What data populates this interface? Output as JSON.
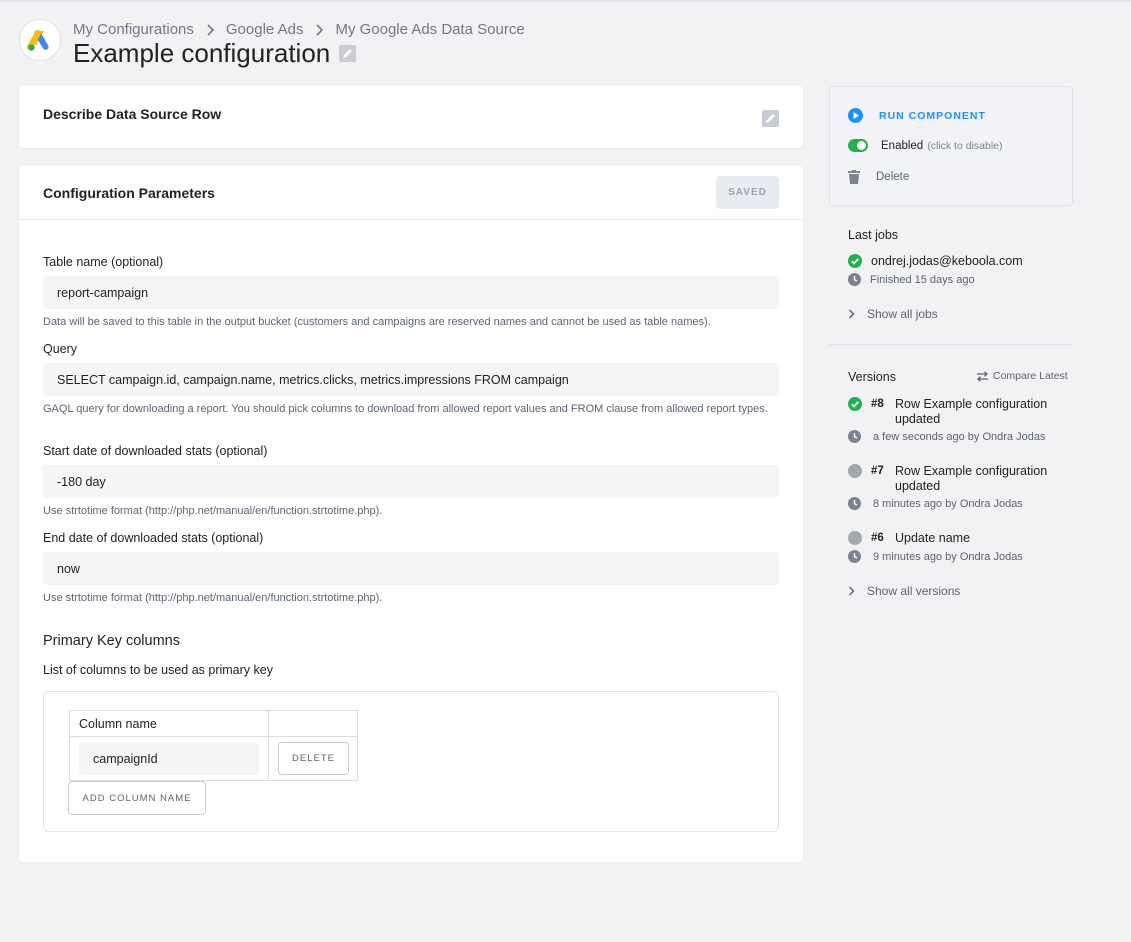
{
  "breadcrumb": {
    "items": [
      "My Configurations",
      "Google Ads",
      "My Google Ads Data Source"
    ]
  },
  "page": {
    "title": "Example configuration"
  },
  "describe": {
    "title": "Describe Data Source Row"
  },
  "config": {
    "title": "Configuration Parameters",
    "saved_label": "SAVED",
    "fields": [
      {
        "label": "Table name (optional)",
        "value": "report-campaign",
        "help": "Data will be saved to this table in the output bucket (customers and campaigns are reserved names and cannot be used as table names)."
      },
      {
        "label": "Query",
        "value": "SELECT campaign.id, campaign.name, metrics.clicks, metrics.impressions FROM campaign",
        "help": "GAQL query for downloading a report. You should pick columns to download from allowed report values and FROM clause from allowed report types."
      },
      {
        "label": "Start date of downloaded stats (optional)",
        "value": "-180 day",
        "help": "Use strtotime format (http://php.net/manual/en/function.strtotime.php)."
      },
      {
        "label": "End date of downloaded stats (optional)",
        "value": "now",
        "help": "Use strtotime format (http://php.net/manual/en/function.strtotime.php)."
      }
    ],
    "primary_key": {
      "title": "Primary Key columns",
      "subtitle": "List of columns to be used as primary key",
      "column_header": "Column name",
      "rows": [
        {
          "value": "campaignId"
        }
      ],
      "delete_label": "DELETE",
      "add_label": "ADD COLUMN NAME"
    }
  },
  "sidebar": {
    "run_label": "RUN COMPONENT",
    "enabled_label": "Enabled",
    "enabled_hint": "(click to disable)",
    "enabled": true,
    "delete_label": "Delete",
    "last_jobs": {
      "title": "Last jobs",
      "job_user": "ondrej.jodas@keboola.com",
      "job_time": "Finished 15 days ago",
      "show_all": "Show all jobs"
    },
    "versions": {
      "title": "Versions",
      "compare_label": "Compare Latest",
      "items": [
        {
          "number": "#8",
          "text": "Row Example configuration updated",
          "meta": "a few seconds ago by Ondra Jodas",
          "status": "success"
        },
        {
          "number": "#7",
          "text": "Row Example configuration updated",
          "meta": "8 minutes ago by Ondra Jodas",
          "status": "inactive"
        },
        {
          "number": "#6",
          "text": "Update name",
          "meta": "9 minutes ago by Ondra Jodas",
          "status": "inactive"
        }
      ],
      "show_all": "Show all versions"
    }
  },
  "colors": {
    "accent_blue": "#1f8fff",
    "success_green": "#22b14c",
    "inactive_grey": "#a5a8ae"
  }
}
